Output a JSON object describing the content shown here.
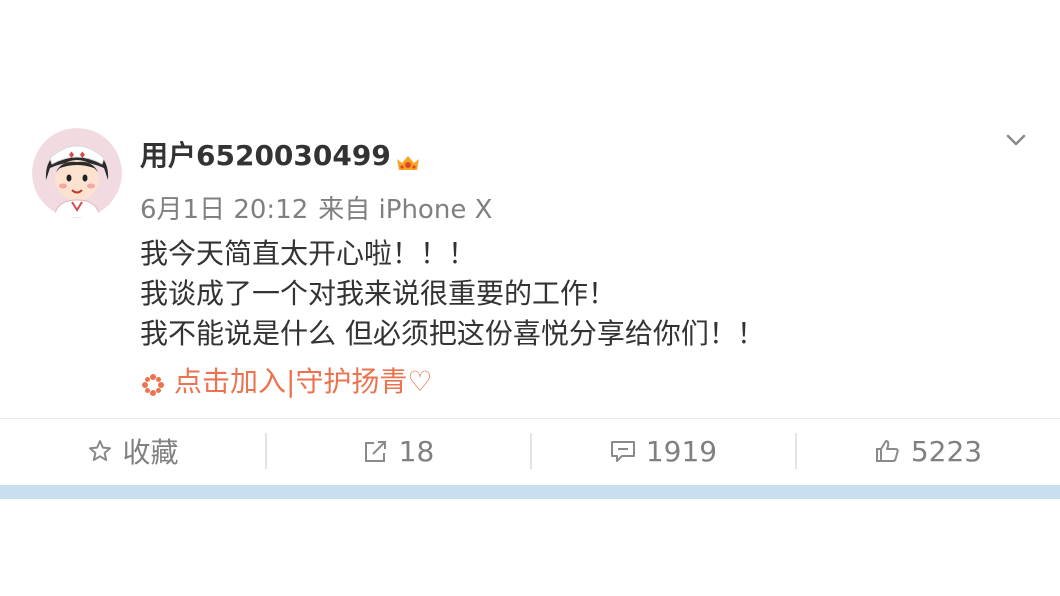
{
  "post": {
    "username": "用户6520030499",
    "time": "6月1日 20:12",
    "source": "来自 iPhone X",
    "lines": [
      "我今天简直太开心啦！！！",
      "我谈成了一个对我来说很重要的工作！",
      "我不能说是什么 但必须把这份喜悦分享给你们！！"
    ],
    "topic": "点击加入|守护扬青♡"
  },
  "actions": {
    "favorite": "收藏",
    "repost": "18",
    "comment": "1919",
    "like": "5223"
  },
  "icons": {
    "avatar": "avatar-illustration",
    "badge": "vip-badge-icon",
    "menu": "chevron-down-icon",
    "topic": "flower-icon",
    "favorite": "star-icon",
    "repost": "share-icon",
    "comment": "comment-icon",
    "like": "thumbs-up-icon"
  },
  "colors": {
    "accent": "#eb7350",
    "text": "#333333",
    "muted": "#808080",
    "band": "#c8dff0"
  }
}
